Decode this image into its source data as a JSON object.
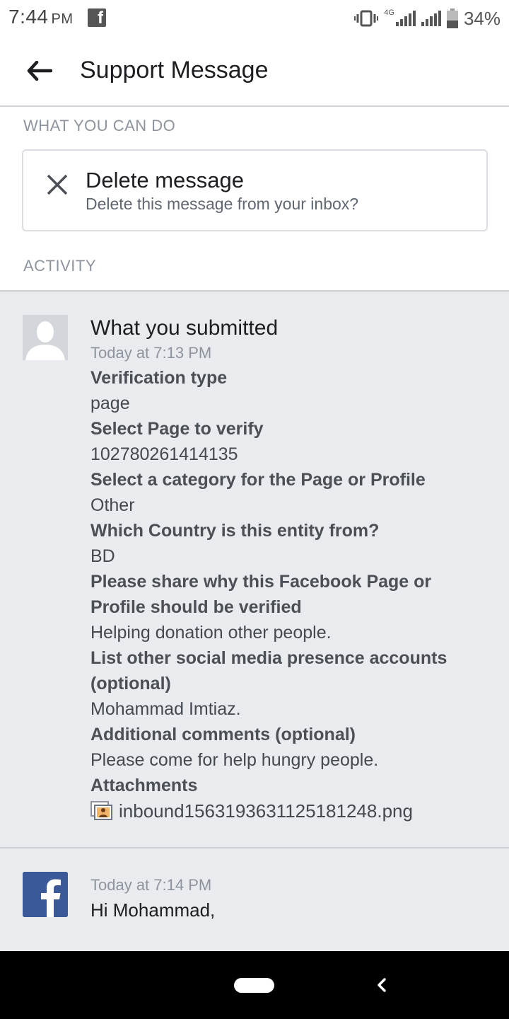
{
  "status_bar": {
    "time": "7:44",
    "ampm": "PM",
    "network": "4G",
    "battery": "34%"
  },
  "header": {
    "title": "Support Message"
  },
  "what_you_can_do": {
    "label": "WHAT YOU CAN DO",
    "delete_title": "Delete message",
    "delete_subtitle": "Delete this message from your inbox?"
  },
  "activity": {
    "label": "ACTIVITY",
    "submission": {
      "title": "What you submitted",
      "time": "Today at 7:13 PM",
      "fields": [
        {
          "label": "Verification type",
          "value": "page"
        },
        {
          "label": "Select Page to verify",
          "value": "102780261414135"
        },
        {
          "label": "Select a category for the Page or Profile",
          "value": "Other"
        },
        {
          "label": "Which Country is this entity from?",
          "value": "BD"
        },
        {
          "label": "Please share why this Facebook Page or Profile should be verified",
          "value": "Helping donation other people."
        },
        {
          "label": "List other social media presence accounts (optional)",
          "value": "Mohammad Imtiaz."
        },
        {
          "label": "Additional comments (optional)",
          "value": "Please come for help hungry people."
        }
      ],
      "attachments_label": "Attachments",
      "attachment_file": "inbound1563193631125181248.png"
    },
    "reply": {
      "time": "Today at 7:14 PM",
      "text": "Hi Mohammad,"
    }
  },
  "colors": {
    "facebook_blue": "#3b5998",
    "activity_bg": "#e9ebee",
    "muted_text": "#8d949e"
  }
}
